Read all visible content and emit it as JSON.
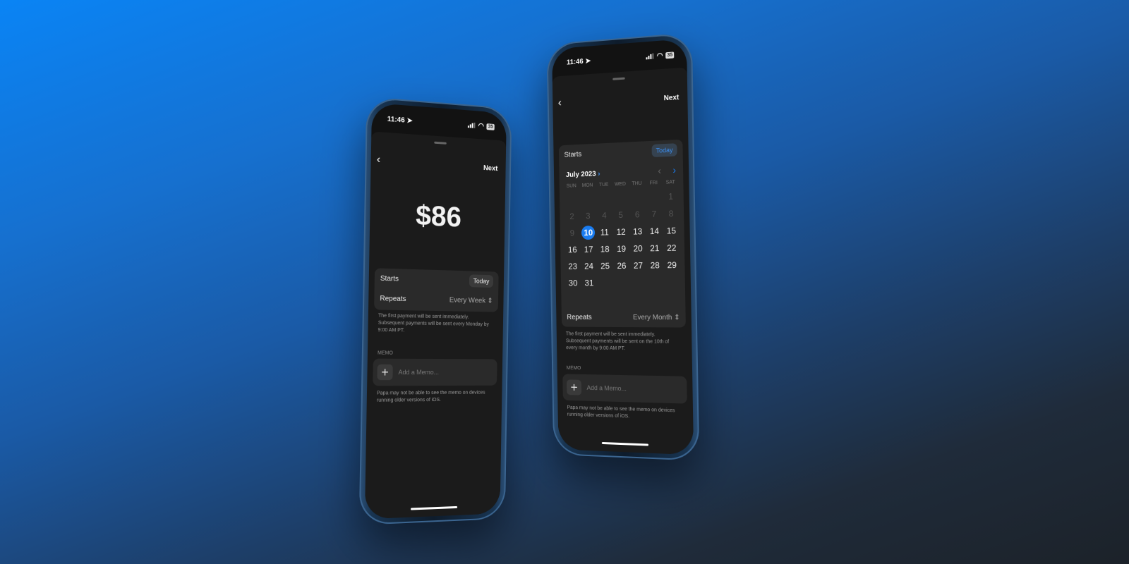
{
  "status_bar": {
    "time": "11:46",
    "battery": "35",
    "location_icon": "location-arrow-icon"
  },
  "colors": {
    "accent": "#1a7cf0",
    "background_top": "#0a84f5",
    "background_bottom": "#1c2229",
    "sheet": "#1b1b1b",
    "card": "#2a2a2a"
  },
  "left_phone": {
    "back_icon": "chevron-left-icon",
    "next_label": "Next",
    "amount": "$86",
    "starts_label": "Starts",
    "starts_value": "Today",
    "repeats_label": "Repeats",
    "repeats_value": "Every Week",
    "repeats_icon": "chevron-up-down-icon",
    "footnote": "The first payment will be sent immediately. Subsequent payments will be sent every Monday by 9:00 AM PT.",
    "memo_label": "MEMO",
    "memo_placeholder": "Add a Memo...",
    "memo_note": "Papa may not be able to see the memo on devices running older versions of iOS."
  },
  "right_phone": {
    "back_icon": "chevron-left-icon",
    "next_label": "Next",
    "starts_label": "Starts",
    "starts_value": "Today",
    "calendar": {
      "month_label": "July 2023",
      "weekdays": [
        "SUN",
        "MON",
        "TUE",
        "WED",
        "THU",
        "FRI",
        "SAT"
      ],
      "days": [
        [
          "",
          "",
          "",
          "",
          "",
          "",
          "1"
        ],
        [
          "2",
          "3",
          "4",
          "5",
          "6",
          "7",
          "8"
        ],
        [
          "9",
          "10",
          "11",
          "12",
          "13",
          "14",
          "15"
        ],
        [
          "16",
          "17",
          "18",
          "19",
          "20",
          "21",
          "22"
        ],
        [
          "23",
          "24",
          "25",
          "26",
          "27",
          "28",
          "29"
        ],
        [
          "30",
          "31",
          "",
          "",
          "",
          "",
          ""
        ]
      ],
      "selected_day": "10",
      "disabled_days": [
        "1",
        "2",
        "3",
        "4",
        "5",
        "6",
        "7",
        "8",
        "9"
      ]
    },
    "repeats_label": "Repeats",
    "repeats_value": "Every Month",
    "footnote": "The first payment will be sent immediately. Subsequent payments will be sent on the 10th of every month by 9:00 AM PT.",
    "memo_label": "MEMO",
    "memo_placeholder": "Add a Memo...",
    "memo_note": "Papa may not be able to see the memo on devices running older versions of iOS."
  }
}
